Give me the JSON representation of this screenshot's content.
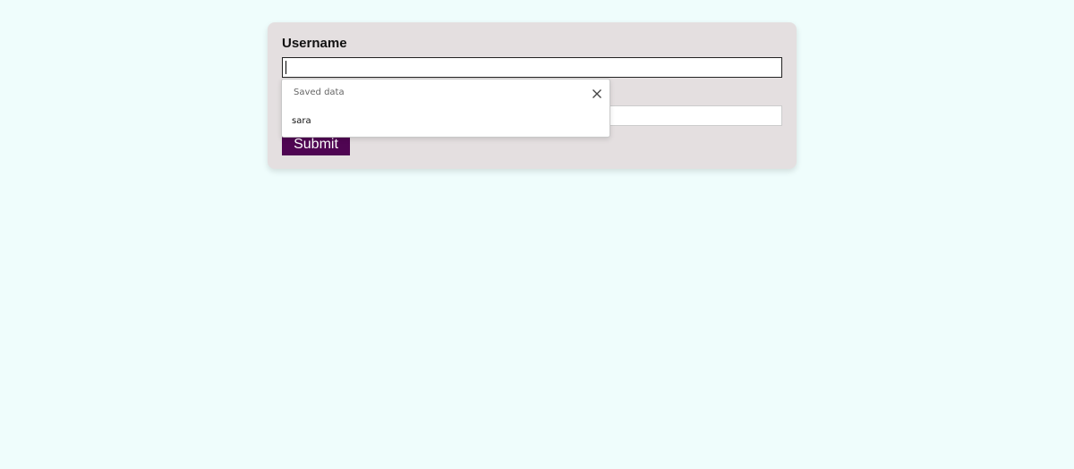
{
  "form": {
    "username_label": "Username",
    "username_value": "",
    "second_field_value": "",
    "submit_label": "Submit"
  },
  "autofill": {
    "title": "Saved data",
    "items": [
      {
        "label": "sara"
      }
    ]
  },
  "colors": {
    "page_background": "#effdfc",
    "card_background": "#e4dfe0",
    "submit_background": "#4f0552",
    "submit_text": "#ffffff"
  },
  "icons": {
    "close": "close-icon"
  }
}
